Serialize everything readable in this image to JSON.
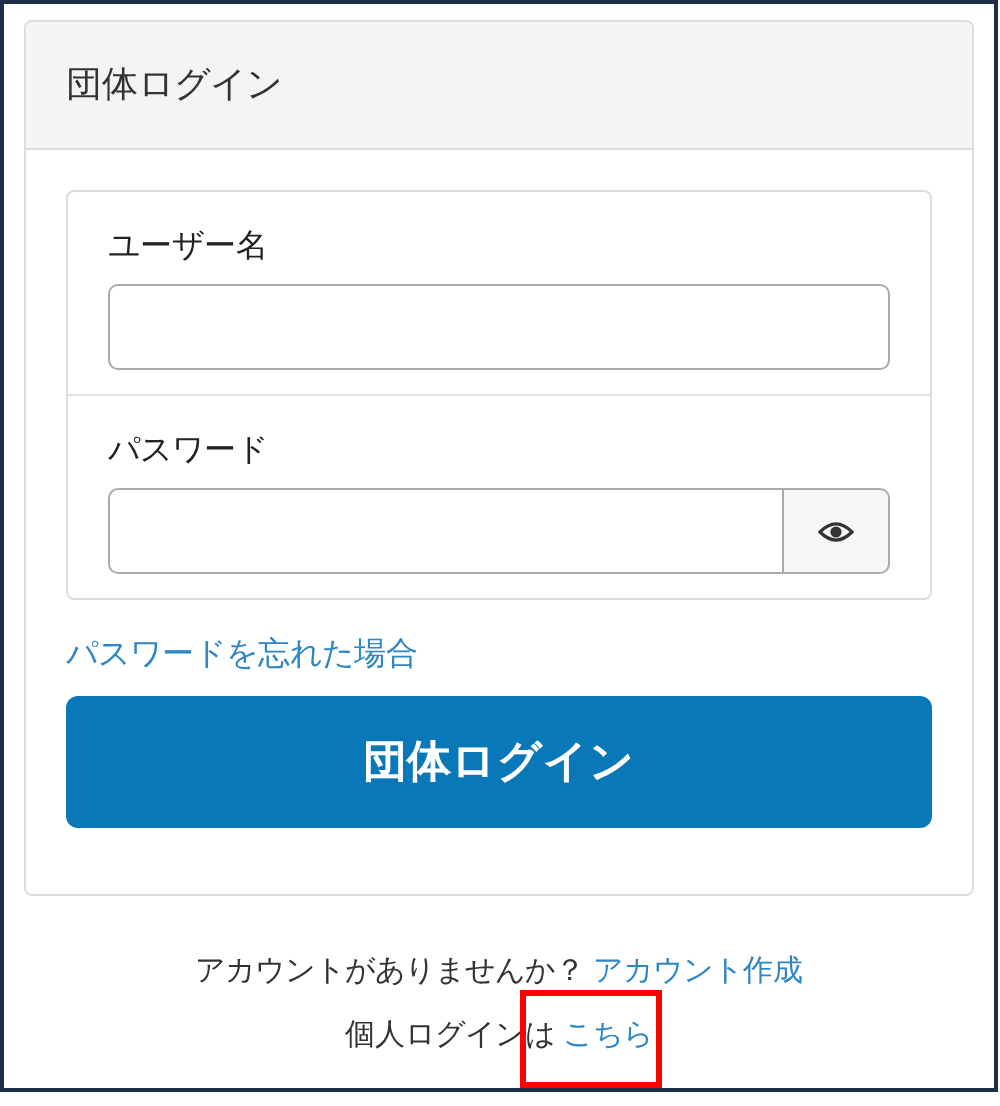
{
  "panel": {
    "title": "団体ログイン"
  },
  "fields": [
    {
      "label": "ユーザー名",
      "kind": "text"
    },
    {
      "label": "パスワード",
      "kind": "password"
    }
  ],
  "forgot_link": "パスワードを忘れた場合",
  "login_button": "団体ログイン",
  "footer": [
    {
      "text": "アカウントがありませんか？",
      "link": "アカウント作成",
      "highlighted": false
    },
    {
      "text": "個人ログインは",
      "link": "こちら",
      "highlighted": true
    }
  ]
}
